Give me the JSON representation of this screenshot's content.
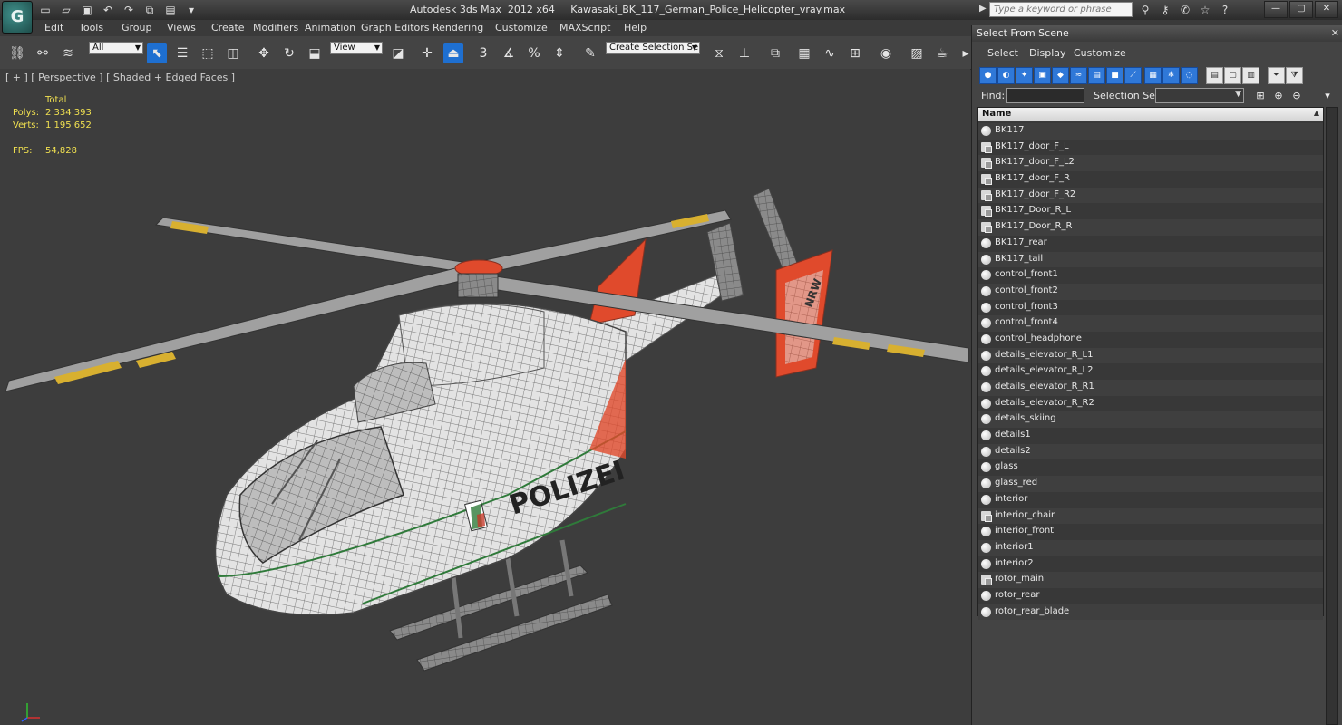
{
  "window": {
    "title": "Autodesk 3ds Max  2012 x64     Kawasaki_BK_117_German_Police_Helicopter_vray.max",
    "search_placeholder": "Type a keyword or phrase",
    "logo_text": "G"
  },
  "menu": [
    "Edit",
    "Tools",
    "Group",
    "Views",
    "Create",
    "Modifiers",
    "Animation",
    "Graph Editors",
    "Rendering",
    "Customize",
    "MAXScript",
    "Help"
  ],
  "toolbar": {
    "filter_value": "All",
    "coord_value": "View",
    "selection_set_value": "Create Selection Se",
    "snap_label": "3",
    "percent_label": "%"
  },
  "viewport": {
    "label": "[ + ] [ Perspective ] [ Shaded + Edged Faces ]",
    "stats": {
      "total_label": "Total",
      "polys_label": "Polys:",
      "polys_value": "2 334 393",
      "verts_label": "Verts:",
      "verts_value": "1 195 652",
      "fps_label": "FPS:",
      "fps_value": "54,828"
    },
    "heli_text": "POLIZEI",
    "tail_text": "NRW"
  },
  "panel": {
    "title": "Select From Scene",
    "menu": [
      "Select",
      "Display",
      "Customize"
    ],
    "find_label": "Find:",
    "selection_set_label": "Selection Set:",
    "column_header": "Name",
    "items": [
      {
        "name": "BK117",
        "type": "object"
      },
      {
        "name": "BK117_door_F_L",
        "type": "group"
      },
      {
        "name": "BK117_door_F_L2",
        "type": "group"
      },
      {
        "name": "BK117_door_F_R",
        "type": "group"
      },
      {
        "name": "BK117_door_F_R2",
        "type": "group"
      },
      {
        "name": "BK117_Door_R_L",
        "type": "group"
      },
      {
        "name": "BK117_Door_R_R",
        "type": "group"
      },
      {
        "name": "BK117_rear",
        "type": "object"
      },
      {
        "name": "BK117_tail",
        "type": "object"
      },
      {
        "name": "control_front1",
        "type": "object"
      },
      {
        "name": "control_front2",
        "type": "object"
      },
      {
        "name": "control_front3",
        "type": "object"
      },
      {
        "name": "control_front4",
        "type": "object"
      },
      {
        "name": "control_headphone",
        "type": "object"
      },
      {
        "name": "details_elevator_R_L1",
        "type": "object"
      },
      {
        "name": "details_elevator_R_L2",
        "type": "object"
      },
      {
        "name": "details_elevator_R_R1",
        "type": "object"
      },
      {
        "name": "details_elevator_R_R2",
        "type": "object"
      },
      {
        "name": "details_skiing",
        "type": "object"
      },
      {
        "name": "details1",
        "type": "object"
      },
      {
        "name": "details2",
        "type": "object"
      },
      {
        "name": "glass",
        "type": "object"
      },
      {
        "name": "glass_red",
        "type": "object"
      },
      {
        "name": "interior",
        "type": "object"
      },
      {
        "name": "interior_chair",
        "type": "group"
      },
      {
        "name": "interior_front",
        "type": "object"
      },
      {
        "name": "interior1",
        "type": "object"
      },
      {
        "name": "interior2",
        "type": "object"
      },
      {
        "name": "rotor_main",
        "type": "group"
      },
      {
        "name": "rotor_rear",
        "type": "object"
      },
      {
        "name": "rotor_rear_blade",
        "type": "object"
      }
    ]
  }
}
